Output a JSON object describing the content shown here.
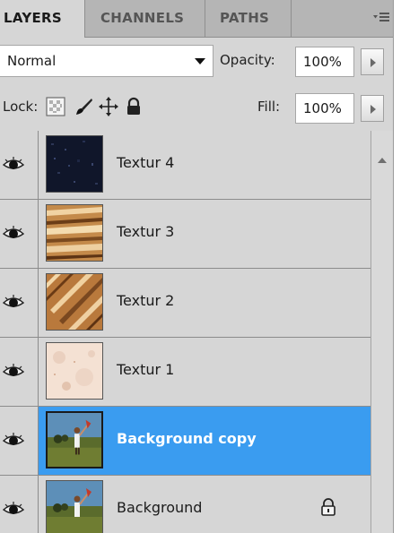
{
  "tabs": [
    {
      "label": "LAYERS",
      "active": true
    },
    {
      "label": "CHANNELS",
      "active": false
    },
    {
      "label": "PATHS",
      "active": false
    }
  ],
  "blend": {
    "mode": "Normal"
  },
  "opacity": {
    "label": "Opacity:",
    "value": "100%"
  },
  "lock": {
    "label": "Lock:",
    "icons": [
      "lock-transparency-icon",
      "lock-paint-icon",
      "lock-position-icon",
      "lock-all-icon"
    ]
  },
  "fill": {
    "label": "Fill:",
    "value": "100%"
  },
  "layers": [
    {
      "name": "Textur 4",
      "thumb": "texture-dark-icon",
      "selected": false,
      "locked": false
    },
    {
      "name": "Textur 3",
      "thumb": "texture-wood-icon",
      "selected": false,
      "locked": false
    },
    {
      "name": "Textur 2",
      "thumb": "texture-wood-diagonal-icon",
      "selected": false,
      "locked": false
    },
    {
      "name": "Textur 1",
      "thumb": "texture-paper-icon",
      "selected": false,
      "locked": false
    },
    {
      "name": "Background copy",
      "thumb": "photo-thumbnail-icon",
      "selected": true,
      "locked": false
    },
    {
      "name": "Background",
      "thumb": "photo-thumbnail-icon",
      "selected": false,
      "locked": true
    }
  ],
  "colors": {
    "selection": "#3a9cf0",
    "panel": "#d6d6d6",
    "tabbar": "#b5b5b5"
  }
}
